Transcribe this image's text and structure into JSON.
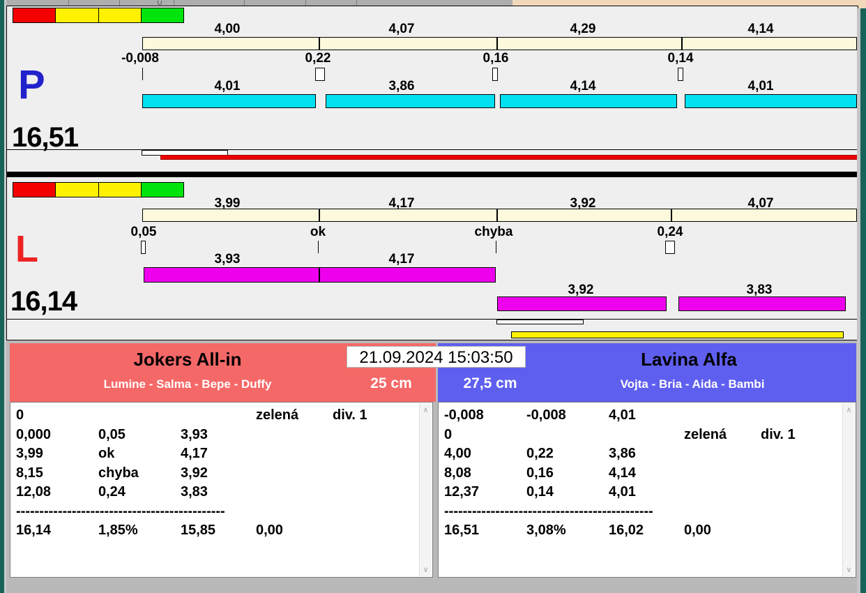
{
  "colors": {
    "window_bg": "#F0F0F0",
    "border_teal": "#17635A",
    "panel_bg": "#F0EFEF",
    "split_bar": "#FCF9DC",
    "lane_p_bar_cyan": "#00E0F0",
    "lane_l_bar_magenta": "#EE00EE",
    "progress_red": "#EE0000",
    "progress_yellow": "#FFF200",
    "team_left_bg": "#F56868",
    "team_right_bg": "#5F5FEF",
    "lane_p_letter": "#2222CC",
    "lane_l_letter": "#EE2222"
  },
  "start_lights": [
    "#F40000",
    "#FFF200",
    "#FFF200",
    "#00E40E"
  ],
  "lane_p": {
    "label": "P",
    "total": "16,51",
    "split_times": [
      "4,00",
      "4,07",
      "4,29",
      "4,14"
    ],
    "change_times": [
      "-0,008",
      "0,22",
      "0,16",
      "0,14"
    ],
    "dog_times": [
      "4,01",
      "3,86",
      "4,14",
      "4,01"
    ]
  },
  "lane_l": {
    "label": "L",
    "total": "16,14",
    "split_times": [
      "3,99",
      "4,17",
      "3,92",
      "4,07"
    ],
    "change_times": [
      "0,05",
      "ok",
      "chyba",
      "0,24"
    ],
    "dog_times_row1": [
      "3,93",
      "4,17"
    ],
    "dog_times_row2": [
      "3,92",
      "3,83"
    ]
  },
  "scoreboard": {
    "timestamp": "21.09.2024 15:03:50",
    "team_left": {
      "name": "Jokers All-in",
      "members": "Lumine - Salma - Bepe - Duffy",
      "height": "25 cm"
    },
    "team_right": {
      "name": "Lavina Alfa",
      "members": "Vojta - Bria - Aida - Bambi",
      "height": "27,5 cm"
    },
    "log_left": {
      "rows": [
        [
          "0",
          "",
          "",
          "zelená",
          "div. 1"
        ],
        [
          "0,000",
          "0,05",
          "3,93",
          "",
          ""
        ],
        [
          "3,99",
          "ok",
          "4,17",
          "",
          ""
        ],
        [
          "8,15",
          "chyba",
          "3,92",
          "",
          ""
        ],
        [
          "12,08",
          "0,24",
          "3,83",
          "",
          ""
        ],
        [
          "---------------------------------------------",
          "",
          "",
          "",
          ""
        ],
        [
          "16,14",
          "1,85%",
          "15,85",
          "0,00",
          ""
        ]
      ]
    },
    "log_right": {
      "rows": [
        [
          "-0,008",
          "-0,008",
          "4,01",
          "",
          ""
        ],
        [
          "0",
          "",
          "",
          "zelená",
          "div. 1"
        ],
        [
          "4,00",
          "0,22",
          "3,86",
          "",
          ""
        ],
        [
          "8,08",
          "0,16",
          "4,14",
          "",
          ""
        ],
        [
          "12,37",
          "0,14",
          "4,01",
          "",
          ""
        ],
        [
          "---------------------------------------------",
          "",
          "",
          "",
          ""
        ],
        [
          "16,51",
          "3,08%",
          "16,02",
          "0,00",
          ""
        ]
      ]
    }
  }
}
